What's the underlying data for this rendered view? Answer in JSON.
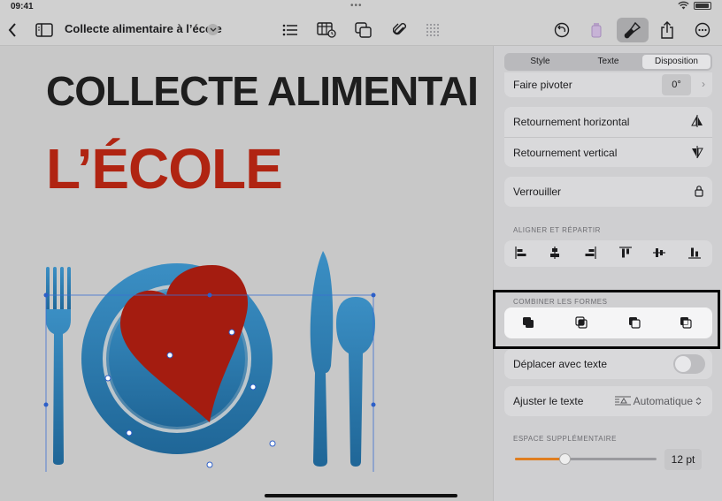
{
  "status": {
    "time": "09:41",
    "dots": "•••"
  },
  "toolbar": {
    "title": "Collecte alimentaire à l’école"
  },
  "canvas": {
    "headline1": "COLLECTE ALIMENTAI",
    "headline2": "L’ÉCOLE"
  },
  "panel": {
    "tabs": [
      "Style",
      "Texte",
      "Disposition"
    ],
    "active_tab": "Disposition",
    "rotate_label": "Faire pivoter",
    "rotate_value": "0°",
    "flip_h_label": "Retournement horizontal",
    "flip_v_label": "Retournement vertical",
    "lock_label": "Verrouiller",
    "align_section": "ALIGNER ET RÉPARTIR",
    "combine_section": "COMBINER LES FORMES",
    "move_with_text_label": "Déplacer avec texte",
    "move_with_text_on": false,
    "wrap_label": "Ajuster le texte",
    "wrap_value": "Automatique",
    "extra_space_section": "ESPACE SUPPLÉMENTAIRE",
    "extra_space_value": "12 pt",
    "extra_space_slider_fraction": 0.35
  },
  "colors": {
    "accent": "#e07e20",
    "headline_red": "#b02412",
    "plate_blue": "#2f82b8"
  }
}
